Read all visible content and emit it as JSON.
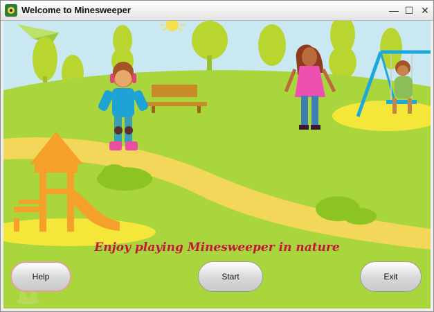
{
  "window": {
    "title": "Welcome to Minesweeper",
    "controls": {
      "minimize": "—",
      "maximize": "☐",
      "close": "✕"
    }
  },
  "scene": {
    "tagline": "Enjoy playing Minesweeper in nature"
  },
  "buttons": {
    "help": "Help",
    "start": "Start",
    "exit": "Exit"
  },
  "colors": {
    "sky": "#c9e8f2",
    "grass": "#a9d63c",
    "path": "#f2d75a",
    "tagline": "#c1183a"
  }
}
